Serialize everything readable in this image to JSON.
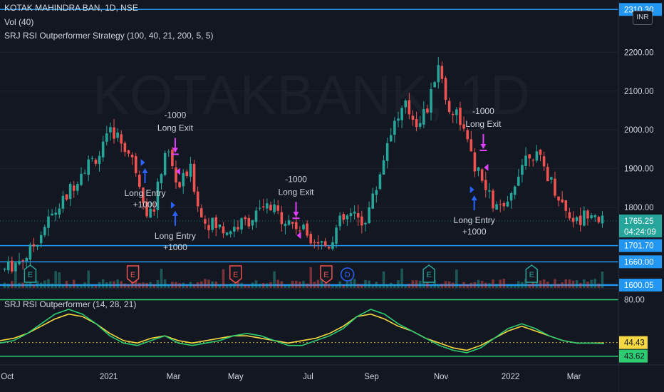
{
  "header": {
    "symbol": "KOTAK MAHINDRA BAN, 1D, NSE",
    "volume": "Vol (40)",
    "strategy": "SRJ RSI Outperformer Strategy (100, 40, 21, 200, 5, 5)",
    "watermark": "KOTAKBANK, 1D",
    "currency": "INR"
  },
  "oscillator": {
    "title": "SRJ RSI Outperformer (14, 28, 21)",
    "level_label": "80.00",
    "value_yellow": "44.43",
    "value_green": "43.62"
  },
  "colors": {
    "background": "#131722",
    "up": "#26a69a",
    "down": "#ef5350",
    "hline": "#2196f3",
    "entry_arrow": "#2962ff",
    "exit_arrow": "#e040fb",
    "osc_yellow": "#f5d742",
    "osc_green": "#2ecc71"
  },
  "chart_data": {
    "type": "candlestick",
    "x_tick_labels": [
      "Oct",
      "2021",
      "Mar",
      "May",
      "Jul",
      "Sep",
      "Nov",
      "2022",
      "Mar"
    ],
    "y_tick_labels": [
      "2200.00",
      "2100.00",
      "2000.00",
      "1900.00",
      "1800.00"
    ],
    "ylim": [
      1600,
      2320
    ],
    "last_price": "1765.25",
    "countdown": "04:24:09",
    "horizontal_levels": [
      {
        "value": 2310.3,
        "label": "2310.30"
      },
      {
        "value": 1701.7,
        "label": "1701.70"
      },
      {
        "value": 1660.0,
        "label": "1660.00"
      },
      {
        "value": 1600.05,
        "label": "1600.05"
      }
    ],
    "price_path": [
      {
        "t": 0.0,
        "p": 1640
      },
      {
        "t": 0.04,
        "p": 1680
      },
      {
        "t": 0.07,
        "p": 1760
      },
      {
        "t": 0.1,
        "p": 1820
      },
      {
        "t": 0.13,
        "p": 1900
      },
      {
        "t": 0.16,
        "p": 1940
      },
      {
        "t": 0.18,
        "p": 2000
      },
      {
        "t": 0.2,
        "p": 1960
      },
      {
        "t": 0.22,
        "p": 1900
      },
      {
        "t": 0.24,
        "p": 1780
      },
      {
        "t": 0.25,
        "p": 1800
      },
      {
        "t": 0.27,
        "p": 1960
      },
      {
        "t": 0.29,
        "p": 1850
      },
      {
        "t": 0.31,
        "p": 1900
      },
      {
        "t": 0.33,
        "p": 1770
      },
      {
        "t": 0.37,
        "p": 1740
      },
      {
        "t": 0.4,
        "p": 1760
      },
      {
        "t": 0.44,
        "p": 1800
      },
      {
        "t": 0.47,
        "p": 1770
      },
      {
        "t": 0.5,
        "p": 1740
      },
      {
        "t": 0.52,
        "p": 1720
      },
      {
        "t": 0.54,
        "p": 1700
      },
      {
        "t": 0.56,
        "p": 1760
      },
      {
        "t": 0.58,
        "p": 1780
      },
      {
        "t": 0.6,
        "p": 1760
      },
      {
        "t": 0.62,
        "p": 1840
      },
      {
        "t": 0.645,
        "p": 2000
      },
      {
        "t": 0.67,
        "p": 2060
      },
      {
        "t": 0.69,
        "p": 2020
      },
      {
        "t": 0.71,
        "p": 2060
      },
      {
        "t": 0.725,
        "p": 2180
      },
      {
        "t": 0.74,
        "p": 2060
      },
      {
        "t": 0.76,
        "p": 2040
      },
      {
        "t": 0.78,
        "p": 1930
      },
      {
        "t": 0.8,
        "p": 1860
      },
      {
        "t": 0.82,
        "p": 1800
      },
      {
        "t": 0.84,
        "p": 1790
      },
      {
        "t": 0.86,
        "p": 1900
      },
      {
        "t": 0.88,
        "p": 1950
      },
      {
        "t": 0.9,
        "p": 1910
      },
      {
        "t": 0.92,
        "p": 1850
      },
      {
        "t": 0.94,
        "p": 1790
      },
      {
        "t": 0.96,
        "p": 1760
      },
      {
        "t": 0.98,
        "p": 1800
      },
      {
        "t": 1.0,
        "p": 1765
      }
    ],
    "earnings_markers": [
      {
        "t": 0.05,
        "label": "E",
        "kind": "green"
      },
      {
        "t": 0.22,
        "label": "E",
        "kind": "red"
      },
      {
        "t": 0.39,
        "label": "E",
        "kind": "red"
      },
      {
        "t": 0.54,
        "label": "E",
        "kind": "red"
      },
      {
        "t": 0.575,
        "label": "D",
        "kind": "blue"
      },
      {
        "t": 0.71,
        "label": "E",
        "kind": "green"
      },
      {
        "t": 0.88,
        "label": "E",
        "kind": "green"
      }
    ],
    "annotations": [
      {
        "t": 0.24,
        "price": 1870,
        "kind": "entry-up",
        "line1": "Long Entry",
        "line2": "+1000"
      },
      {
        "t": 0.29,
        "price": 1950,
        "kind": "exit-down",
        "line1": "-1000",
        "line2": "Long Exit"
      },
      {
        "t": 0.29,
        "price": 1760,
        "kind": "entry-up",
        "line1": "Long Entry",
        "line2": "+1000"
      },
      {
        "t": 0.49,
        "price": 1785,
        "kind": "exit-down",
        "line1": "-1000",
        "line2": "Long Exit"
      },
      {
        "t": 0.8,
        "price": 1960,
        "kind": "exit-down",
        "line1": "-1000",
        "line2": "Long Exit"
      },
      {
        "t": 0.785,
        "price": 1800,
        "kind": "entry-up",
        "line1": "Long Entry",
        "line2": "+1000"
      }
    ],
    "oscillator_series": [
      {
        "name": "",
        "color": "yellow",
        "values": [
          46,
          48,
          52,
          58,
          64,
          68,
          66,
          60,
          52,
          46,
          44,
          48,
          50,
          46,
          44,
          46,
          48,
          50,
          50,
          48,
          46,
          44,
          46,
          48,
          52,
          58,
          66,
          68,
          64,
          58,
          54,
          48,
          44,
          40,
          38,
          42,
          48,
          54,
          58,
          54,
          50,
          46,
          44,
          44,
          44
        ]
      },
      {
        "name": "",
        "color": "green",
        "values": [
          44,
          46,
          52,
          60,
          68,
          72,
          68,
          60,
          50,
          44,
          42,
          46,
          50,
          44,
          42,
          44,
          46,
          50,
          52,
          50,
          46,
          42,
          42,
          46,
          50,
          56,
          66,
          72,
          68,
          60,
          54,
          48,
          42,
          38,
          36,
          40,
          48,
          56,
          60,
          56,
          50,
          46,
          44,
          44,
          43.6
        ]
      }
    ],
    "oscillator_ylim": [
      30,
      85
    ]
  }
}
